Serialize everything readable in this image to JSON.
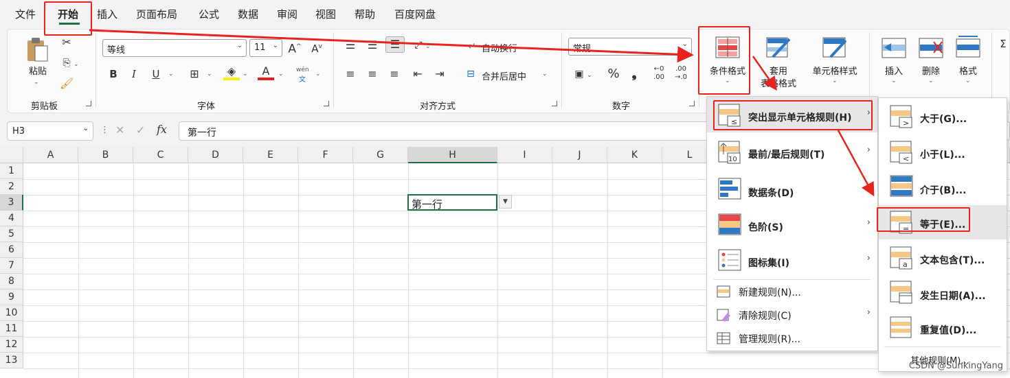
{
  "tabs": [
    "文件",
    "开始",
    "插入",
    "页面布局",
    "公式",
    "数据",
    "审阅",
    "视图",
    "帮助",
    "百度网盘"
  ],
  "active_tab": "开始",
  "ribbon": {
    "clipboard": {
      "paste_label": "粘贴",
      "group_label": "剪贴板"
    },
    "font": {
      "font_name": "等线",
      "font_size": "11",
      "bold": "B",
      "italic": "I",
      "underline": "U",
      "wen": "wén",
      "wen_sub": "文",
      "group_label": "字体"
    },
    "alignment": {
      "wrap_label": "自动换行",
      "merge_label": "合并后居中",
      "group_label": "对齐方式"
    },
    "number": {
      "format": "常规",
      "percent": "%",
      "comma": "❟",
      "group_label": "数字"
    },
    "styles": {
      "cond_format_line1": "条件格式",
      "table_format_line1": "套用",
      "table_format_line2": "表格格式",
      "cell_styles": "单元格样式"
    },
    "cells": {
      "insert": "插入",
      "delete": "删除",
      "format": "格式"
    }
  },
  "formula_bar": {
    "name_box": "H3",
    "fx": "fx",
    "value": "第一行"
  },
  "columns": [
    "A",
    "B",
    "C",
    "D",
    "E",
    "F",
    "G",
    "H",
    "I",
    "J",
    "K",
    "L"
  ],
  "rows": [
    "1",
    "2",
    "3",
    "4",
    "5",
    "6",
    "7",
    "8",
    "9",
    "10",
    "11",
    "12",
    "13"
  ],
  "active_cell_value": "第一行",
  "cond_menu": {
    "items": [
      {
        "label": "突出显示单元格规则(H)",
        "arrow": "›"
      },
      {
        "label": "最前/最后规则(T)",
        "arrow": "›"
      },
      {
        "label": "数据条(D)",
        "arrow": "›"
      },
      {
        "label": "色阶(S)",
        "arrow": "›"
      },
      {
        "label": "图标集(I)",
        "arrow": "›"
      }
    ],
    "small_items": [
      {
        "label": "新建规则(N)..."
      },
      {
        "label": "清除规则(C)",
        "arrow": "›"
      },
      {
        "label": "管理规则(R)..."
      }
    ]
  },
  "sub_menu": {
    "items": [
      {
        "label": "大于(G)..."
      },
      {
        "label": "小于(L)..."
      },
      {
        "label": "介于(B)..."
      },
      {
        "label": "等于(E)..."
      },
      {
        "label": "文本包含(T)..."
      },
      {
        "label": "发生日期(A)..."
      },
      {
        "label": "重复值(D)..."
      }
    ],
    "other": "其他规则(M)..."
  },
  "watermark": "CSDN @SunkingYang",
  "colors": {
    "accent": "#1e7145",
    "highlight_red": "#e8231d",
    "menu_hover": "#e6e6e6"
  }
}
